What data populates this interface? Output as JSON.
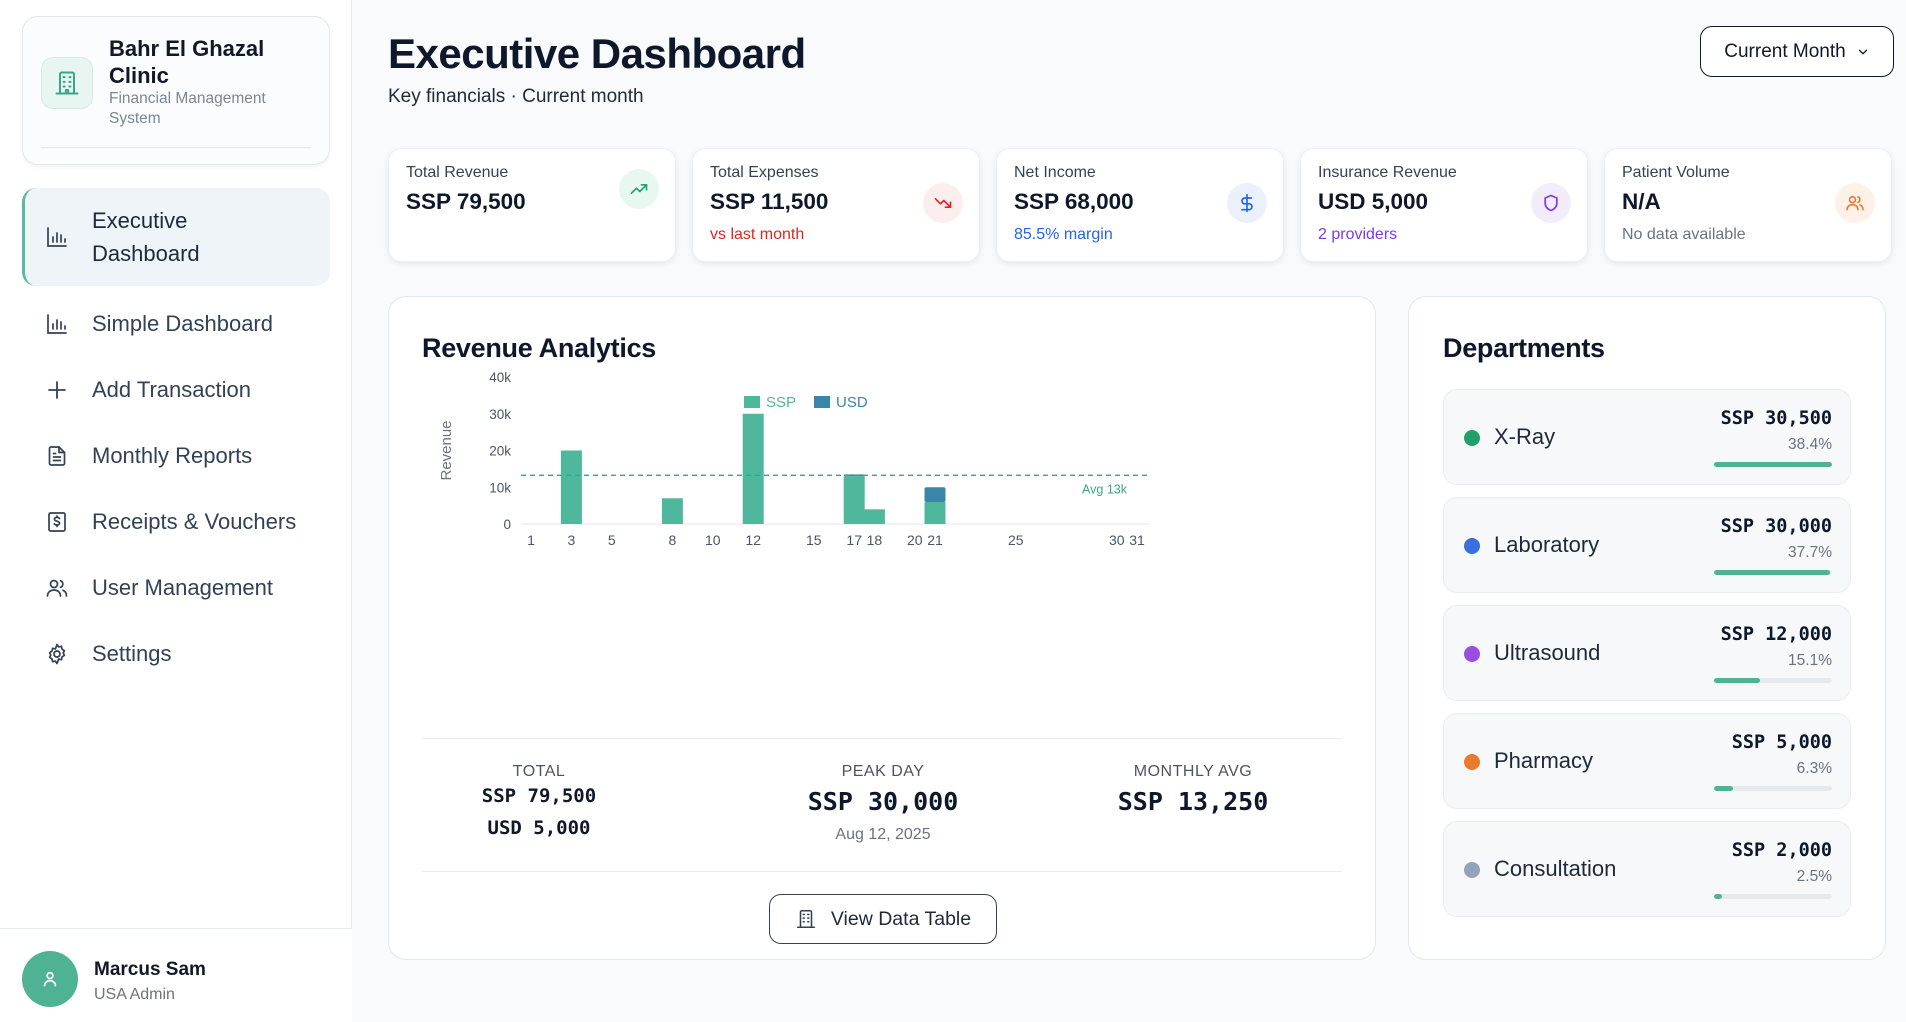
{
  "brand": {
    "title": "Bahr El Ghazal Clinic",
    "subtitle": "Financial Management System"
  },
  "nav": [
    {
      "label": "Executive Dashboard",
      "icon": "bar-chart-icon",
      "active": true
    },
    {
      "label": "Simple Dashboard",
      "icon": "bar-chart-icon"
    },
    {
      "label": "Add Transaction",
      "icon": "plus-icon"
    },
    {
      "label": "Monthly Reports",
      "icon": "document-icon"
    },
    {
      "label": "Receipts & Vouchers",
      "icon": "receipt-icon"
    },
    {
      "label": "User Management",
      "icon": "users-icon"
    },
    {
      "label": "Settings",
      "icon": "gear-icon"
    }
  ],
  "user": {
    "name": "Marcus Sam",
    "role": "USA Admin"
  },
  "header": {
    "title": "Executive Dashboard",
    "subtitle": "Key financials · Current month",
    "period": "Current Month"
  },
  "kpis": [
    {
      "label": "Total Revenue",
      "value": "SSP 79,500",
      "note": "",
      "icon": "trending-up-icon",
      "color": "#22a06b"
    },
    {
      "label": "Total Expenses",
      "value": "SSP 11,500",
      "note": "vs last month",
      "icon": "trending-down-icon",
      "color": "#dc2626"
    },
    {
      "label": "Net Income",
      "value": "SSP 68,000",
      "note": "85.5% margin",
      "icon": "dollar-icon",
      "color": "#2563eb"
    },
    {
      "label": "Insurance Revenue",
      "value": "USD 5,000",
      "note": "2 providers",
      "icon": "shield-icon",
      "color": "#7c3aed"
    },
    {
      "label": "Patient Volume",
      "value": "N/A",
      "note": "No data available",
      "icon": "users-icon",
      "color": "#ea7a3a"
    }
  ],
  "revenue": {
    "title": "Revenue Analytics",
    "avg_label": "Avg 13k",
    "stats": {
      "total_label": "TOTAL",
      "total_ssp": "SSP 79,500",
      "total_usd": "USD 5,000",
      "peak_label": "PEAK DAY",
      "peak_value": "SSP 30,000",
      "peak_date": "Aug 12, 2025",
      "avg_label": "MONTHLY AVG",
      "avg_value": "SSP 13,250"
    },
    "table_button": "View Data Table"
  },
  "chart_data": {
    "type": "bar",
    "stacked": true,
    "ylabel": "Revenue",
    "xlabel": "",
    "ylim": [
      0,
      40000
    ],
    "y_ticks": [
      "0",
      "10k",
      "20k",
      "30k",
      "40k"
    ],
    "y_tick_values": [
      0,
      10000,
      20000,
      30000,
      40000
    ],
    "x_ticks": [
      1,
      3,
      5,
      8,
      10,
      12,
      15,
      17,
      18,
      20,
      21,
      25,
      30,
      31
    ],
    "x_domain": [
      1,
      31
    ],
    "legend": "top",
    "average": 13250,
    "series": [
      {
        "name": "SSP",
        "color": "#4fb89c",
        "points": [
          [
            3,
            20000
          ],
          [
            8,
            7000
          ],
          [
            12,
            30000
          ],
          [
            17,
            13000
          ],
          [
            18,
            4000
          ],
          [
            21,
            6000
          ]
        ]
      },
      {
        "name": "USD",
        "color": "#3a86a8",
        "points": [
          [
            17,
            500
          ],
          [
            21,
            4000
          ]
        ]
      }
    ]
  },
  "departments": {
    "title": "Departments",
    "items": [
      {
        "name": "X-Ray",
        "amount": "SSP 30,500",
        "pct": "38.4%",
        "share": 0.384,
        "color": "#22a06b"
      },
      {
        "name": "Laboratory",
        "amount": "SSP 30,000",
        "pct": "37.7%",
        "share": 0.377,
        "color": "#3b6fe0"
      },
      {
        "name": "Ultrasound",
        "amount": "SSP 12,000",
        "pct": "15.1%",
        "share": 0.151,
        "color": "#9b4de0"
      },
      {
        "name": "Pharmacy",
        "amount": "SSP 5,000",
        "pct": "6.3%",
        "share": 0.063,
        "color": "#ea7a2e"
      },
      {
        "name": "Consultation",
        "amount": "SSP 2,000",
        "pct": "2.5%",
        "share": 0.025,
        "color": "#94a3b8"
      }
    ]
  }
}
